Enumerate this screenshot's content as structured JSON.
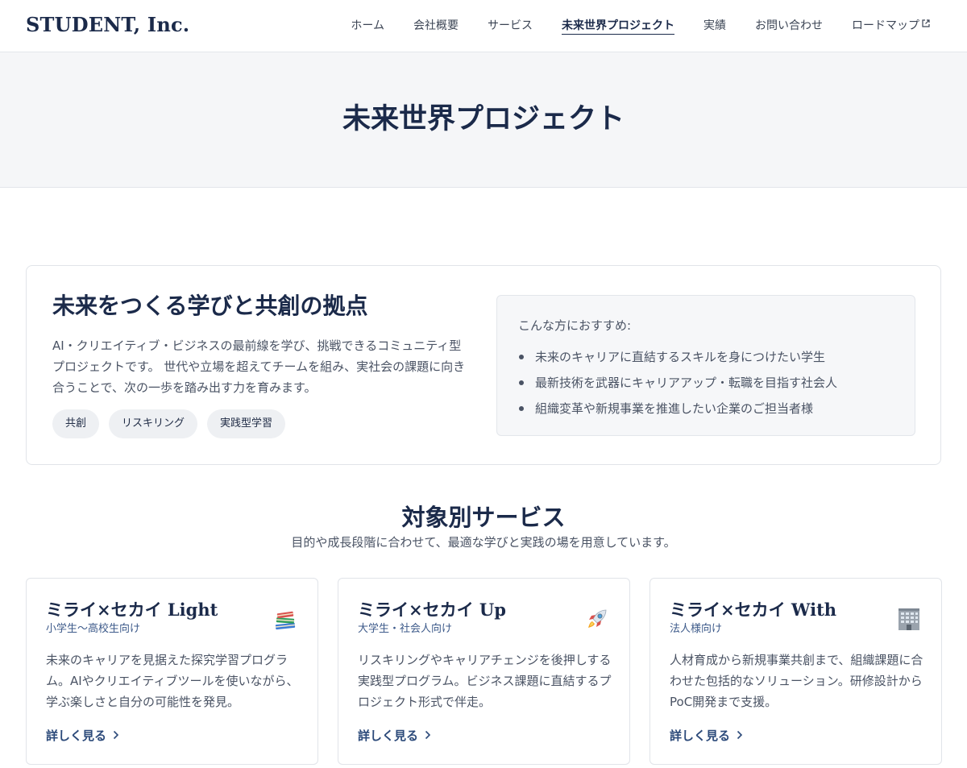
{
  "header": {
    "logo": "STUDENT, Inc.",
    "nav": [
      {
        "label": "ホーム"
      },
      {
        "label": "会社概要"
      },
      {
        "label": "サービス"
      },
      {
        "label": "未来世界プロジェクト",
        "active": true
      },
      {
        "label": "実績"
      },
      {
        "label": "お問い合わせ"
      },
      {
        "label": "ロードマップ",
        "external": true
      }
    ]
  },
  "hero": {
    "title": "未来世界プロジェクト"
  },
  "intro": {
    "heading": "未来をつくる学びと共創の拠点",
    "description": "AI・クリエイティブ・ビジネスの最前線を学び、挑戦できるコミュニティ型プロジェクトです。 世代や立場を超えてチームを組み、実社会の課題に向き合うことで、次の一歩を踏み出す力を育みます。",
    "tags": [
      "共創",
      "リスキリング",
      "実践型学習"
    ],
    "recommend": {
      "title": "こんな方におすすめ:",
      "items": [
        "未来のキャリアに直結するスキルを身につけたい学生",
        "最新技術を武器にキャリアアップ・転職を目指す社会人",
        "組織変革や新規事業を推進したい企業のご担当者様"
      ]
    }
  },
  "services": {
    "title": "対象別サービス",
    "subtitle": "目的や成長段階に合わせて、最適な学びと実践の場を用意しています。",
    "cards": [
      {
        "title": "ミライ×セカイ Light",
        "target": "小学生〜高校生向け",
        "icon": "books-icon",
        "description": "未来のキャリアを見据えた探究学習プログラム。AIやクリエイティブツールを使いながら、学ぶ楽しさと自分の可能性を発見。",
        "link": "詳しく見る"
      },
      {
        "title": "ミライ×セカイ Up",
        "target": "大学生・社会人向け",
        "icon": "rocket-icon",
        "description": "リスキリングやキャリアチェンジを後押しする実践型プログラム。ビジネス課題に直結するプロジェクト形式で伴走。",
        "link": "詳しく見る"
      },
      {
        "title": "ミライ×セカイ With",
        "target": "法人様向け",
        "icon": "office-building-icon",
        "description": "人材育成から新規事業共創まで、組織課題に合わせた包括的なソリューション。研修設計からPoC開発まで支援。",
        "link": "詳しく見る"
      }
    ]
  },
  "colors": {
    "primary": "#1b2a4a",
    "text": "#4a5364",
    "accent_link": "#2c4a7a",
    "hero_bg": "#f5f6f8",
    "tag_bg": "#eef0f3"
  }
}
